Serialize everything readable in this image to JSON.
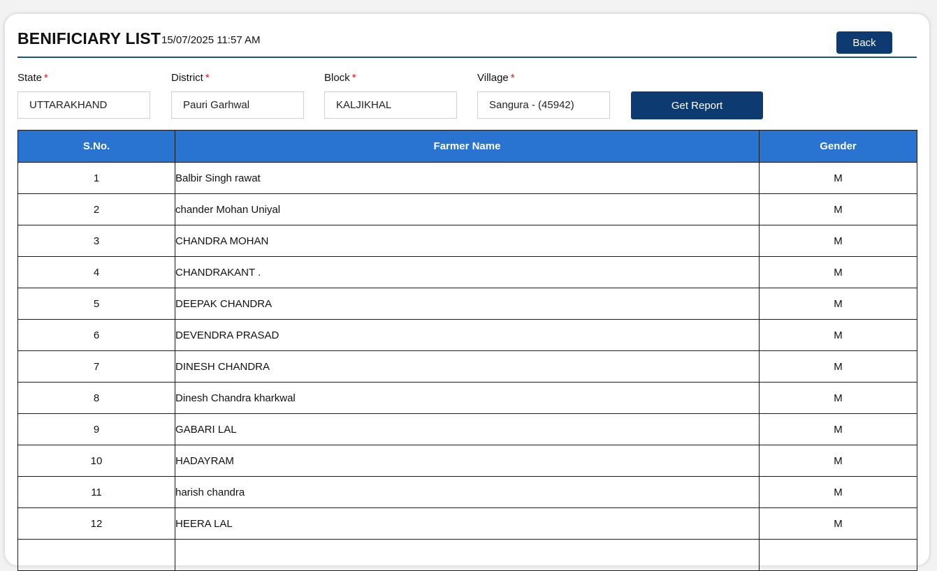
{
  "header": {
    "title": "BENIFICIARY LIST",
    "timestamp": "15/07/2025 11:57 AM",
    "back_label": "Back"
  },
  "filters": {
    "state": {
      "label": "State",
      "required_mark": "*",
      "value": "UTTARAKHAND"
    },
    "district": {
      "label": "District",
      "required_mark": "*",
      "value": "Pauri Garhwal"
    },
    "block": {
      "label": "Block",
      "required_mark": "*",
      "value": "KALJIKHAL"
    },
    "village": {
      "label": "Village",
      "required_mark": "*",
      "value": "Sangura - (45942)"
    },
    "report_button_label": "Get Report"
  },
  "table": {
    "columns": [
      "S.No.",
      "Farmer Name",
      "Gender"
    ],
    "rows": [
      {
        "sno": "1",
        "name": "Balbir Singh rawat",
        "gender": "M"
      },
      {
        "sno": "2",
        "name": "chander Mohan Uniyal",
        "gender": "M"
      },
      {
        "sno": "3",
        "name": "CHANDRA MOHAN",
        "gender": "M"
      },
      {
        "sno": "4",
        "name": "CHANDRAKANT .",
        "gender": "M"
      },
      {
        "sno": "5",
        "name": "DEEPAK CHANDRA",
        "gender": "M"
      },
      {
        "sno": "6",
        "name": "DEVENDRA PRASAD",
        "gender": "M"
      },
      {
        "sno": "7",
        "name": "DINESH CHANDRA",
        "gender": "M"
      },
      {
        "sno": "8",
        "name": "Dinesh Chandra kharkwal",
        "gender": "M"
      },
      {
        "sno": "9",
        "name": "GABARI LAL",
        "gender": "M"
      },
      {
        "sno": "10",
        "name": "HADAYRAM",
        "gender": "M"
      },
      {
        "sno": "11",
        "name": "harish chandra",
        "gender": "M"
      },
      {
        "sno": "12",
        "name": "HEERA LAL",
        "gender": "M"
      }
    ]
  },
  "colors": {
    "header_blue": "#2874d0",
    "button_navy": "#0d3a70",
    "required_red": "#d81c1c"
  }
}
